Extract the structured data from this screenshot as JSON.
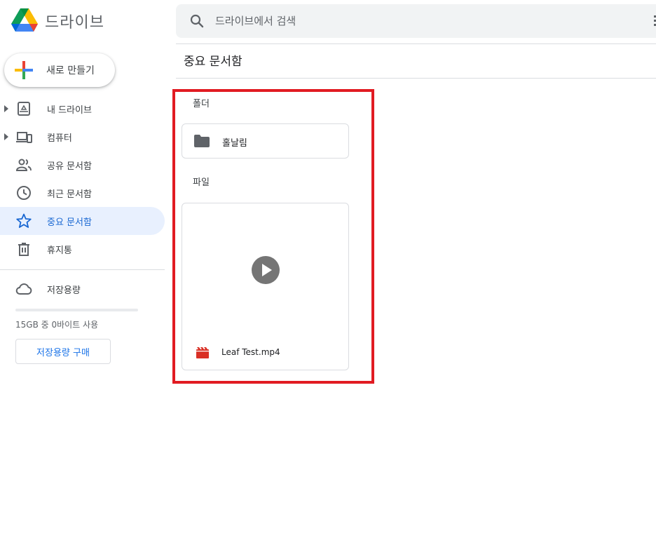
{
  "app": {
    "title": "드라이브"
  },
  "search": {
    "placeholder": "드라이브에서 검색"
  },
  "new_button": {
    "label": "새로 만들기"
  },
  "nav": {
    "items": [
      {
        "label": "내 드라이브",
        "icon": "my-drive-icon"
      },
      {
        "label": "컴퓨터",
        "icon": "computers-icon"
      },
      {
        "label": "공유 문서함",
        "icon": "shared-icon"
      },
      {
        "label": "최근 문서함",
        "icon": "clock-icon"
      },
      {
        "label": "중요 문서함",
        "icon": "star-icon",
        "active": true
      },
      {
        "label": "휴지통",
        "icon": "trash-icon"
      }
    ],
    "storage_label": "저장용량",
    "storage_text": "15GB 중 0바이트 사용",
    "storage_used_fraction": 0,
    "buy_storage_label": "저장용량 구매"
  },
  "main": {
    "title": "중요 문서함",
    "folders_label": "폴더",
    "files_label": "파일",
    "folders": [
      {
        "name": "홀날림"
      }
    ],
    "files": [
      {
        "name": "Leaf Test.mp4",
        "type": "video"
      }
    ]
  },
  "colors": {
    "accent": "#1967d2",
    "active_bg": "#e8f0fe",
    "highlight_border": "#e11b22",
    "video_icon": "#d93025"
  }
}
